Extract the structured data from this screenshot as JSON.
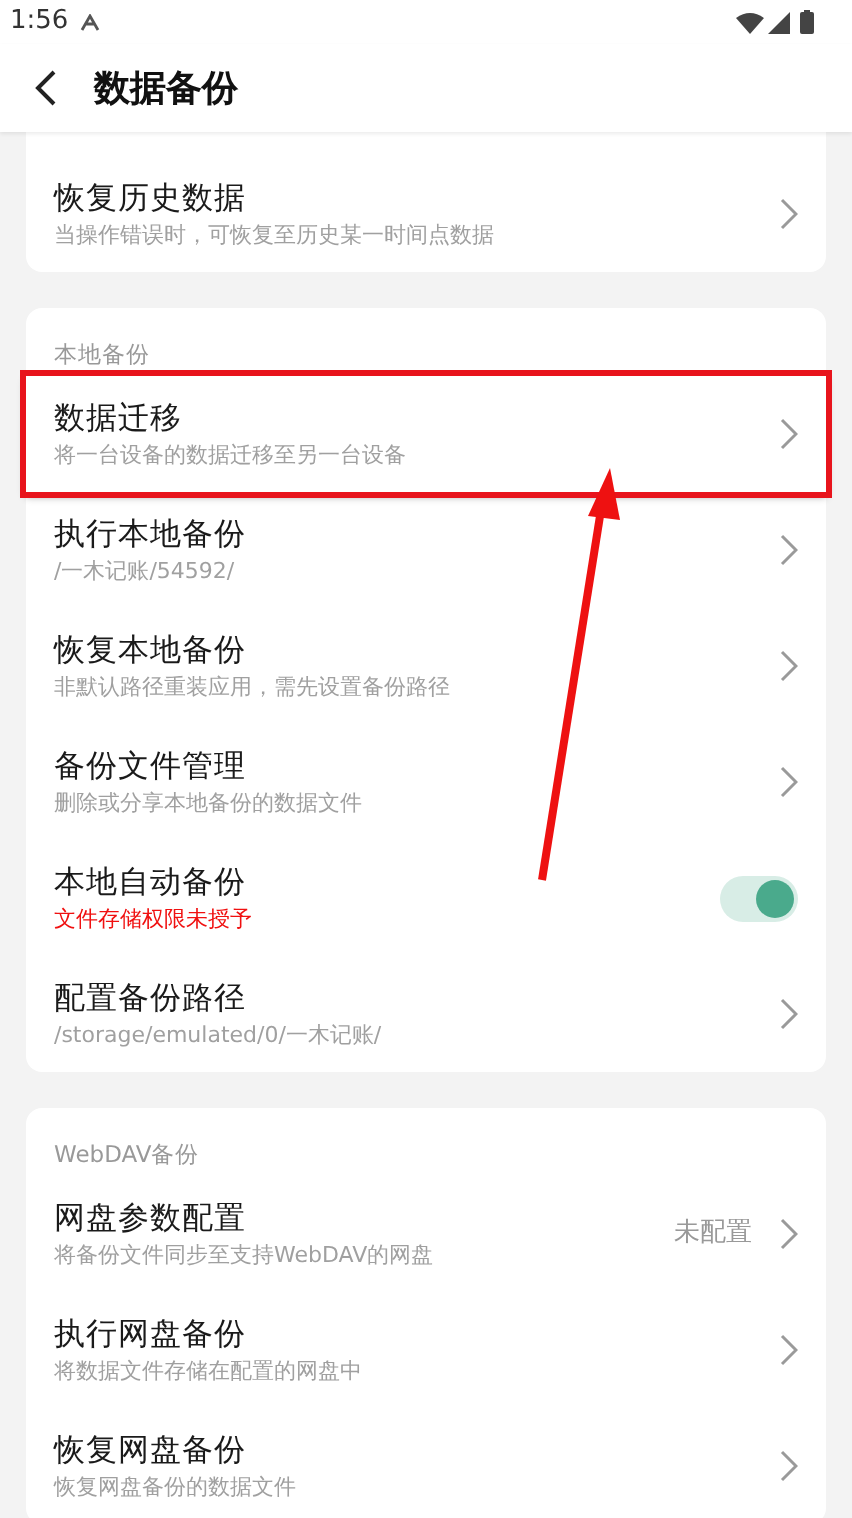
{
  "status_bar": {
    "time": "1:56"
  },
  "header": {
    "title": "数据备份"
  },
  "sections": [
    {
      "rows": [
        {
          "kind": "link",
          "title": "恢复历史数据",
          "subtitle": "当操作错误时，可恢复至历史某一时间点数据",
          "highlighted": false
        }
      ]
    },
    {
      "label": "本地备份",
      "rows": [
        {
          "kind": "link",
          "title": "数据迁移",
          "subtitle": "将一台设备的数据迁移至另一台设备",
          "highlighted": true
        },
        {
          "kind": "link",
          "title": "执行本地备份",
          "subtitle": "/一木记账/54592/",
          "highlighted": false
        },
        {
          "kind": "link",
          "title": "恢复本地备份",
          "subtitle": "非默认路径重装应用，需先设置备份路径",
          "highlighted": false
        },
        {
          "kind": "link",
          "title": "备份文件管理",
          "subtitle": "删除或分享本地备份的数据文件",
          "highlighted": false
        },
        {
          "kind": "toggle",
          "title": "本地自动备份",
          "subtitle": "文件存储权限未授予",
          "warning": true,
          "on": true,
          "highlighted": false
        },
        {
          "kind": "link",
          "title": "配置备份路径",
          "subtitle": "/storage/emulated/0/一木记账/",
          "highlighted": false
        }
      ]
    },
    {
      "label": "WebDAV备份",
      "rows": [
        {
          "kind": "link",
          "title": "网盘参数配置",
          "subtitle": "将备份文件同步至支持WebDAV的网盘",
          "value": "未配置",
          "highlighted": false
        },
        {
          "kind": "link",
          "title": "执行网盘备份",
          "subtitle": "将数据文件存储在配置的网盘中",
          "highlighted": false
        },
        {
          "kind": "link",
          "title": "恢复网盘备份",
          "subtitle": "恢复网盘备份的数据文件",
          "highlighted": false
        }
      ]
    }
  ]
}
